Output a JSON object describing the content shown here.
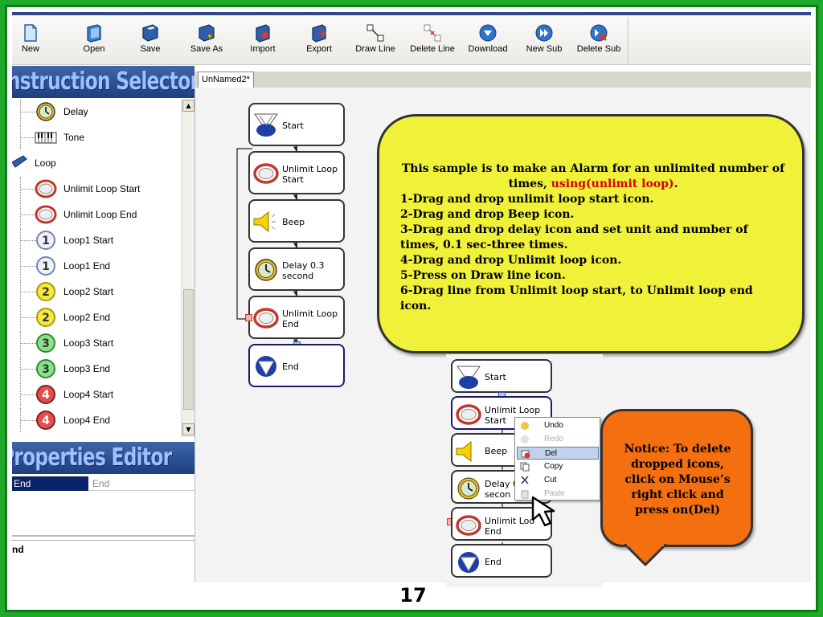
{
  "toolbar": {
    "buttons": [
      {
        "id": "new",
        "label": "New",
        "icon": "new-document-icon"
      },
      {
        "id": "open",
        "label": "Open",
        "icon": "open-folder-icon"
      },
      {
        "id": "save",
        "label": "Save",
        "icon": "floppy-disk-icon"
      },
      {
        "id": "save_as",
        "label": "Save As",
        "icon": "save-as-icon"
      },
      {
        "id": "import",
        "label": "Import",
        "icon": "import-icon"
      },
      {
        "id": "export",
        "label": "Export",
        "icon": "export-icon"
      },
      {
        "id": "draw_line",
        "label": "Draw Line",
        "icon": "draw-line-icon"
      },
      {
        "id": "delete_line",
        "label": "Delete Line",
        "icon": "delete-line-icon"
      },
      {
        "id": "download",
        "label": "Download",
        "icon": "download-icon"
      },
      {
        "id": "new_sub",
        "label": "New Sub",
        "icon": "new-sub-icon"
      },
      {
        "id": "delete_sub",
        "label": "Delete Sub",
        "icon": "delete-sub-icon"
      }
    ]
  },
  "instruction_selector": {
    "title": "Instruction Selector",
    "items": [
      {
        "label": "Delay",
        "icon": "clock-icon"
      },
      {
        "label": "Tone",
        "icon": "piano-icon"
      },
      {
        "label": "Loop",
        "icon": "loop-folder-icon",
        "root": true
      },
      {
        "label": "Unlimit Loop Start",
        "icon": "loop-ring-icon"
      },
      {
        "label": "Unlimit Loop End",
        "icon": "loop-ring-icon"
      },
      {
        "label": "Loop1 Start",
        "icon": "loop-1-icon"
      },
      {
        "label": "Loop1 End",
        "icon": "loop-1-icon"
      },
      {
        "label": "Loop2 Start",
        "icon": "loop-2-icon"
      },
      {
        "label": "Loop2 End",
        "icon": "loop-2-icon"
      },
      {
        "label": "Loop3 Start",
        "icon": "loop-3-icon"
      },
      {
        "label": "Loop3 End",
        "icon": "loop-3-icon"
      },
      {
        "label": "Loop4 Start",
        "icon": "loop-4-icon"
      },
      {
        "label": "Loop4 End",
        "icon": "loop-4-icon"
      }
    ]
  },
  "properties_editor": {
    "title": "Properties Editor",
    "property_name": "End",
    "property_value": "End",
    "description": "nd"
  },
  "workspace": {
    "tab_label": "UnNamed2*",
    "flow": [
      {
        "label": "Start",
        "icon": "start-icon"
      },
      {
        "label": "Unlimit Loop Start",
        "icon": "loop-ring-icon"
      },
      {
        "label": "Beep",
        "icon": "speaker-icon"
      },
      {
        "label": "Delay 0.3 second",
        "icon": "clock-icon"
      },
      {
        "label": "Unlimit Loop End",
        "icon": "loop-ring-icon"
      },
      {
        "label": "End",
        "icon": "end-icon"
      }
    ]
  },
  "instructions_callout": {
    "line1a": "This sample is to make an Alarm for an unlimited number of times, ",
    "line1b": "using(unlimit loop)",
    "line1c": ".",
    "steps": [
      "1-Drag and drop unlimit loop start icon.",
      "2-Drag and drop Beep icon.",
      "3-Drag and drop delay icon and set unit and number of times, 0.1 sec-three times.",
      "4-Drag and drop Unlimit loop icon.",
      "5-Press on Draw line icon.",
      "6-Drag line from Unlimit loop start, to Unlimit loop end icon."
    ]
  },
  "example_shot": {
    "flow": [
      {
        "label": "Start"
      },
      {
        "label": "Unlimit Loop Start"
      },
      {
        "label": "Beep"
      },
      {
        "label": "Delay 0.3 secon"
      },
      {
        "label": "Unlimit Loo End"
      },
      {
        "label": "End"
      }
    ],
    "context_menu": [
      {
        "label": "Undo",
        "icon": "undo-icon",
        "disabled": false
      },
      {
        "label": "Redo",
        "icon": "redo-icon",
        "disabled": true
      },
      {
        "label": "Del",
        "icon": "delete-icon",
        "disabled": false,
        "selected": true
      },
      {
        "label": "Copy",
        "icon": "copy-icon",
        "disabled": false
      },
      {
        "label": "Cut",
        "icon": "scissors-icon",
        "disabled": false
      },
      {
        "label": "Paste",
        "icon": "paste-icon",
        "disabled": true
      }
    ]
  },
  "notice_callout": {
    "text": "Notice: To delete dropped icons, click on Mouse’s right click and press on(Del)"
  },
  "slide_number": "17",
  "colors": {
    "frame_green": "#1fa82a",
    "panel_blue": "#1c3f80",
    "callout_yellow": "#f0f23a",
    "callout_orange": "#f36f10",
    "highlight_red": "#d10000"
  }
}
